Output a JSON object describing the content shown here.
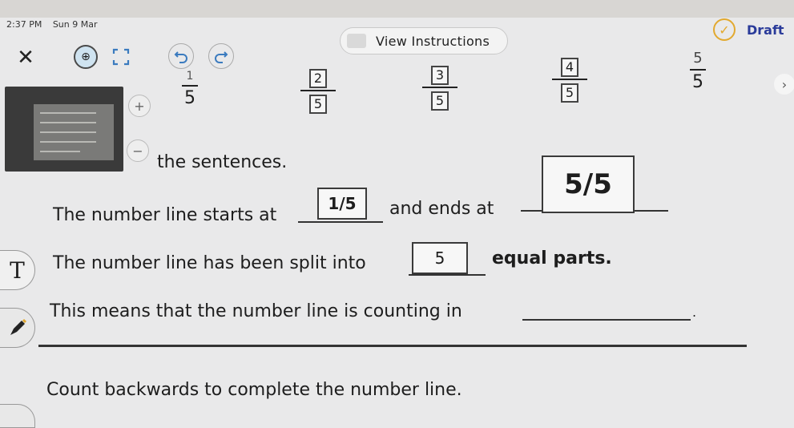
{
  "status_bar": {
    "time": "2:37 PM",
    "date": "Sun 9 Mar"
  },
  "toolbar": {
    "view_instructions_label": "View Instructions"
  },
  "draft_label": "Draft",
  "fractions": [
    {
      "numerator": "1",
      "denominator": "5"
    },
    {
      "numerator": "2",
      "denominator": "5"
    },
    {
      "numerator": "3",
      "denominator": "5"
    },
    {
      "numerator": "4",
      "denominator": "5"
    },
    {
      "numerator": "5",
      "denominator": "5"
    }
  ],
  "instructions": {
    "heading_fragment": "the sentences."
  },
  "sentence1": {
    "part1": "The number line starts at",
    "start_value": "1/5",
    "part2": "and ends at",
    "end_value": "5/5"
  },
  "sentence2": {
    "part1": "The number line has been split into",
    "parts_value": "5",
    "part2": "equal parts."
  },
  "sentence3": {
    "part1": "This means that the number line is counting in",
    "part2": "."
  },
  "task2": {
    "instruction": "Count backwards to complete the number line."
  },
  "tools": {
    "text_tool_label": "T"
  }
}
